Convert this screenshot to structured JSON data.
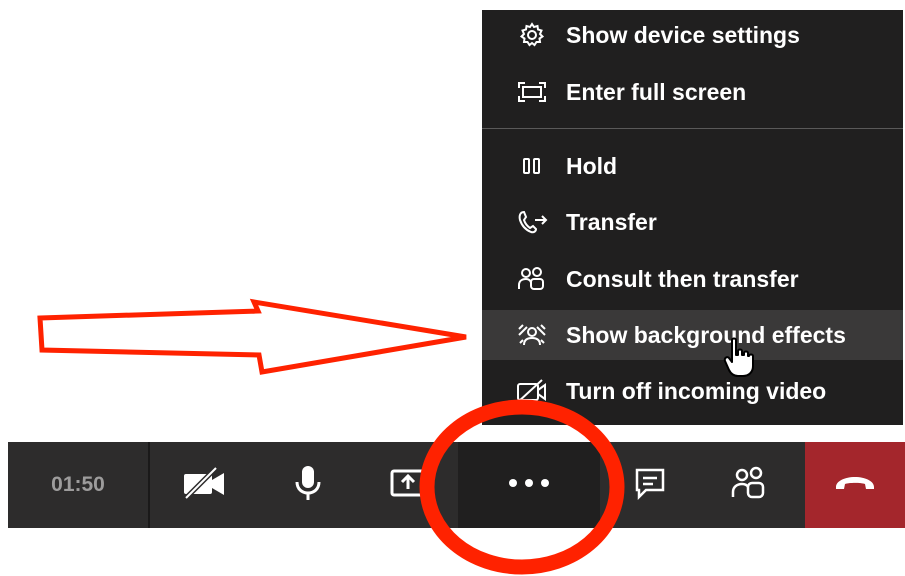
{
  "menu": {
    "items": [
      {
        "label": "Show device settings",
        "icon": "gear-icon"
      },
      {
        "label": "Enter full screen",
        "icon": "fullscreen-icon"
      },
      {
        "label": "Hold",
        "icon": "pause-icon"
      },
      {
        "label": "Transfer",
        "icon": "transfer-icon"
      },
      {
        "label": "Consult then transfer",
        "icon": "consult-icon"
      },
      {
        "label": "Show background effects",
        "icon": "background-effects-icon",
        "state": "hovered"
      },
      {
        "label": "Turn off incoming video",
        "icon": "video-off-icon"
      }
    ]
  },
  "call_bar": {
    "timer": "01:50",
    "buttons": [
      "camera-off-icon",
      "microphone-icon",
      "share-screen-icon",
      "more-actions-icon",
      "chat-icon",
      "participants-icon",
      "hang-up-icon"
    ]
  },
  "colors": {
    "menu_bg": "#201f1f",
    "menu_hover": "#3a3939",
    "bar_bg": "#2d2c2c",
    "hangup": "#a4262c",
    "annotation": "#ff2200"
  }
}
